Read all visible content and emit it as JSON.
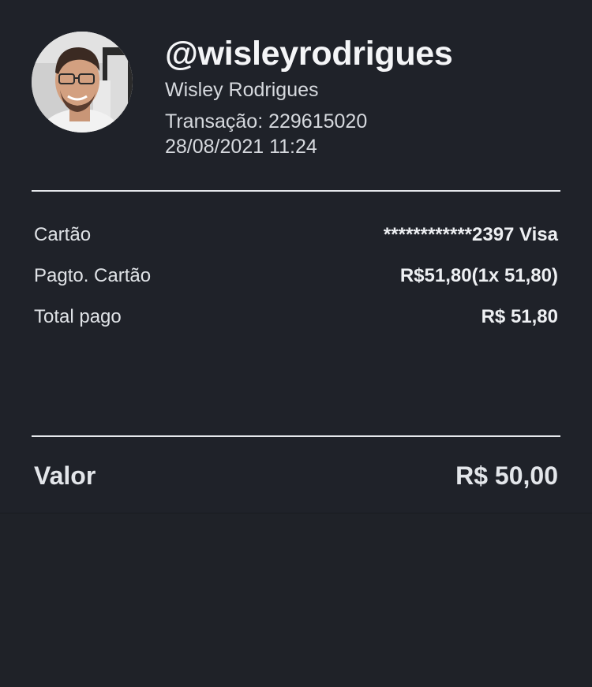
{
  "profile": {
    "handle": "@wisleyrodrigues",
    "name": "Wisley Rodrigues",
    "transaction_label": "Transação:",
    "transaction_id": "229615020",
    "datetime": "28/08/2021 11:24"
  },
  "details": {
    "rows": [
      {
        "label": "Cartão",
        "value": "************2397 Visa"
      },
      {
        "label": "Pagto. Cartão",
        "value": "R$51,80(1x 51,80)"
      },
      {
        "label": "Total pago",
        "value": "R$ 51,80"
      }
    ]
  },
  "summary": {
    "label": "Valor",
    "value": "R$ 50,00"
  },
  "colors": {
    "background": "#1f2228",
    "text": "#e9ebef",
    "divider": "#e6e8ec"
  }
}
